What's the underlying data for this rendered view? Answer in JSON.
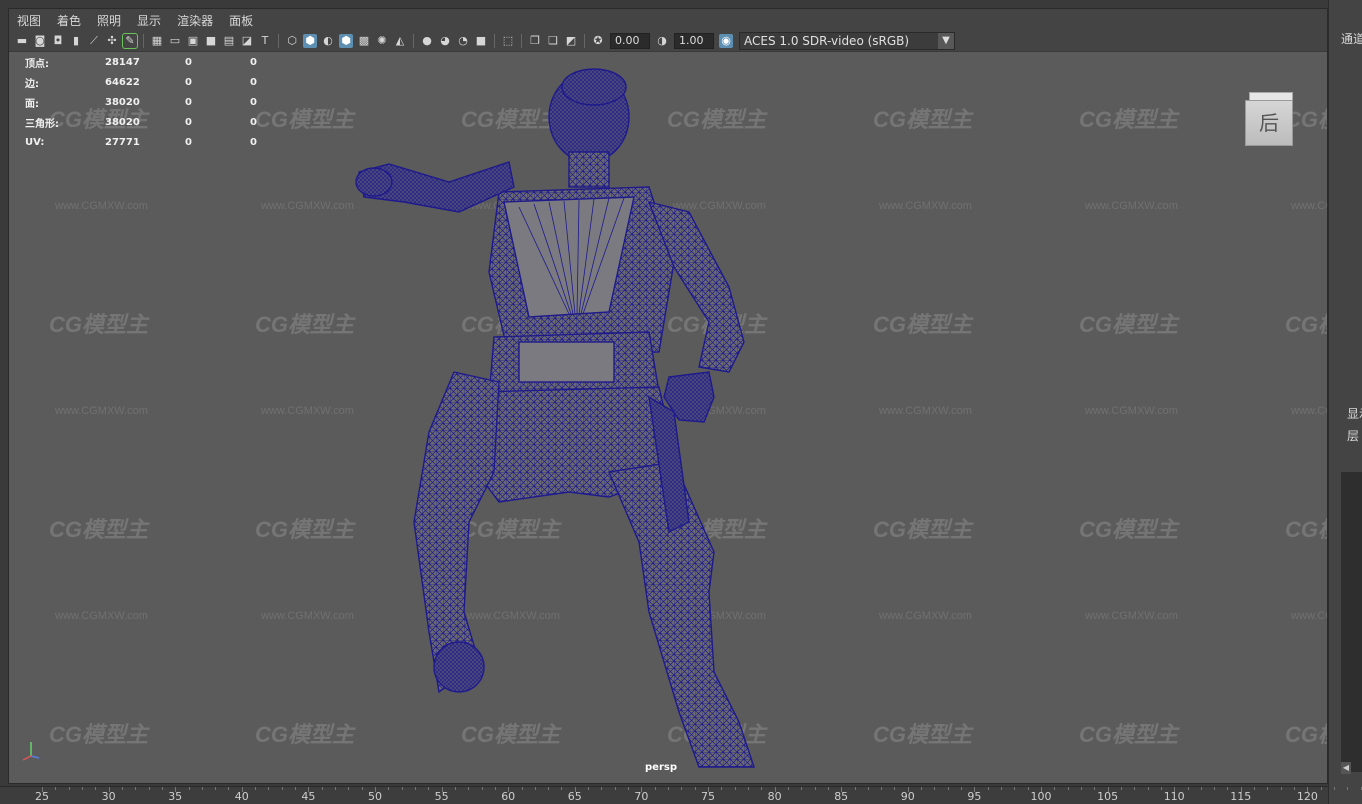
{
  "menu": [
    "视图",
    "着色",
    "照明",
    "显示",
    "渲染器",
    "面板"
  ],
  "toolbar": {
    "exposure": "0.00",
    "gamma": "1.00",
    "color_space": "ACES 1.0 SDR-video (sRGB)"
  },
  "hud": {
    "rows": [
      {
        "label": "顶点:",
        "values": [
          "28147",
          "0",
          "0"
        ]
      },
      {
        "label": "边:",
        "values": [
          "64622",
          "0",
          "0"
        ]
      },
      {
        "label": "面:",
        "values": [
          "38020",
          "0",
          "0"
        ]
      },
      {
        "label": "三角形:",
        "values": [
          "38020",
          "0",
          "0"
        ]
      },
      {
        "label": "UV:",
        "values": [
          "27771",
          "0",
          "0"
        ]
      }
    ]
  },
  "view_cube_label": "后",
  "camera_label": "persp",
  "watermark": {
    "logo": "CG模型主",
    "url": "www.CGMXW.com"
  },
  "right_panel": {
    "tab1": "通道",
    "tab2": "显示",
    "tab3": "层"
  },
  "timeline": {
    "ticks": [
      "25",
      "30",
      "35",
      "40",
      "45",
      "50",
      "55",
      "60",
      "65",
      "70",
      "75",
      "80",
      "85",
      "90",
      "95",
      "100",
      "105",
      "110",
      "115",
      "120"
    ]
  },
  "colors": {
    "wireframe": "#1e1a8c",
    "viewport_bg": "#5b5b5b",
    "active_button": "#5d8fb2"
  }
}
